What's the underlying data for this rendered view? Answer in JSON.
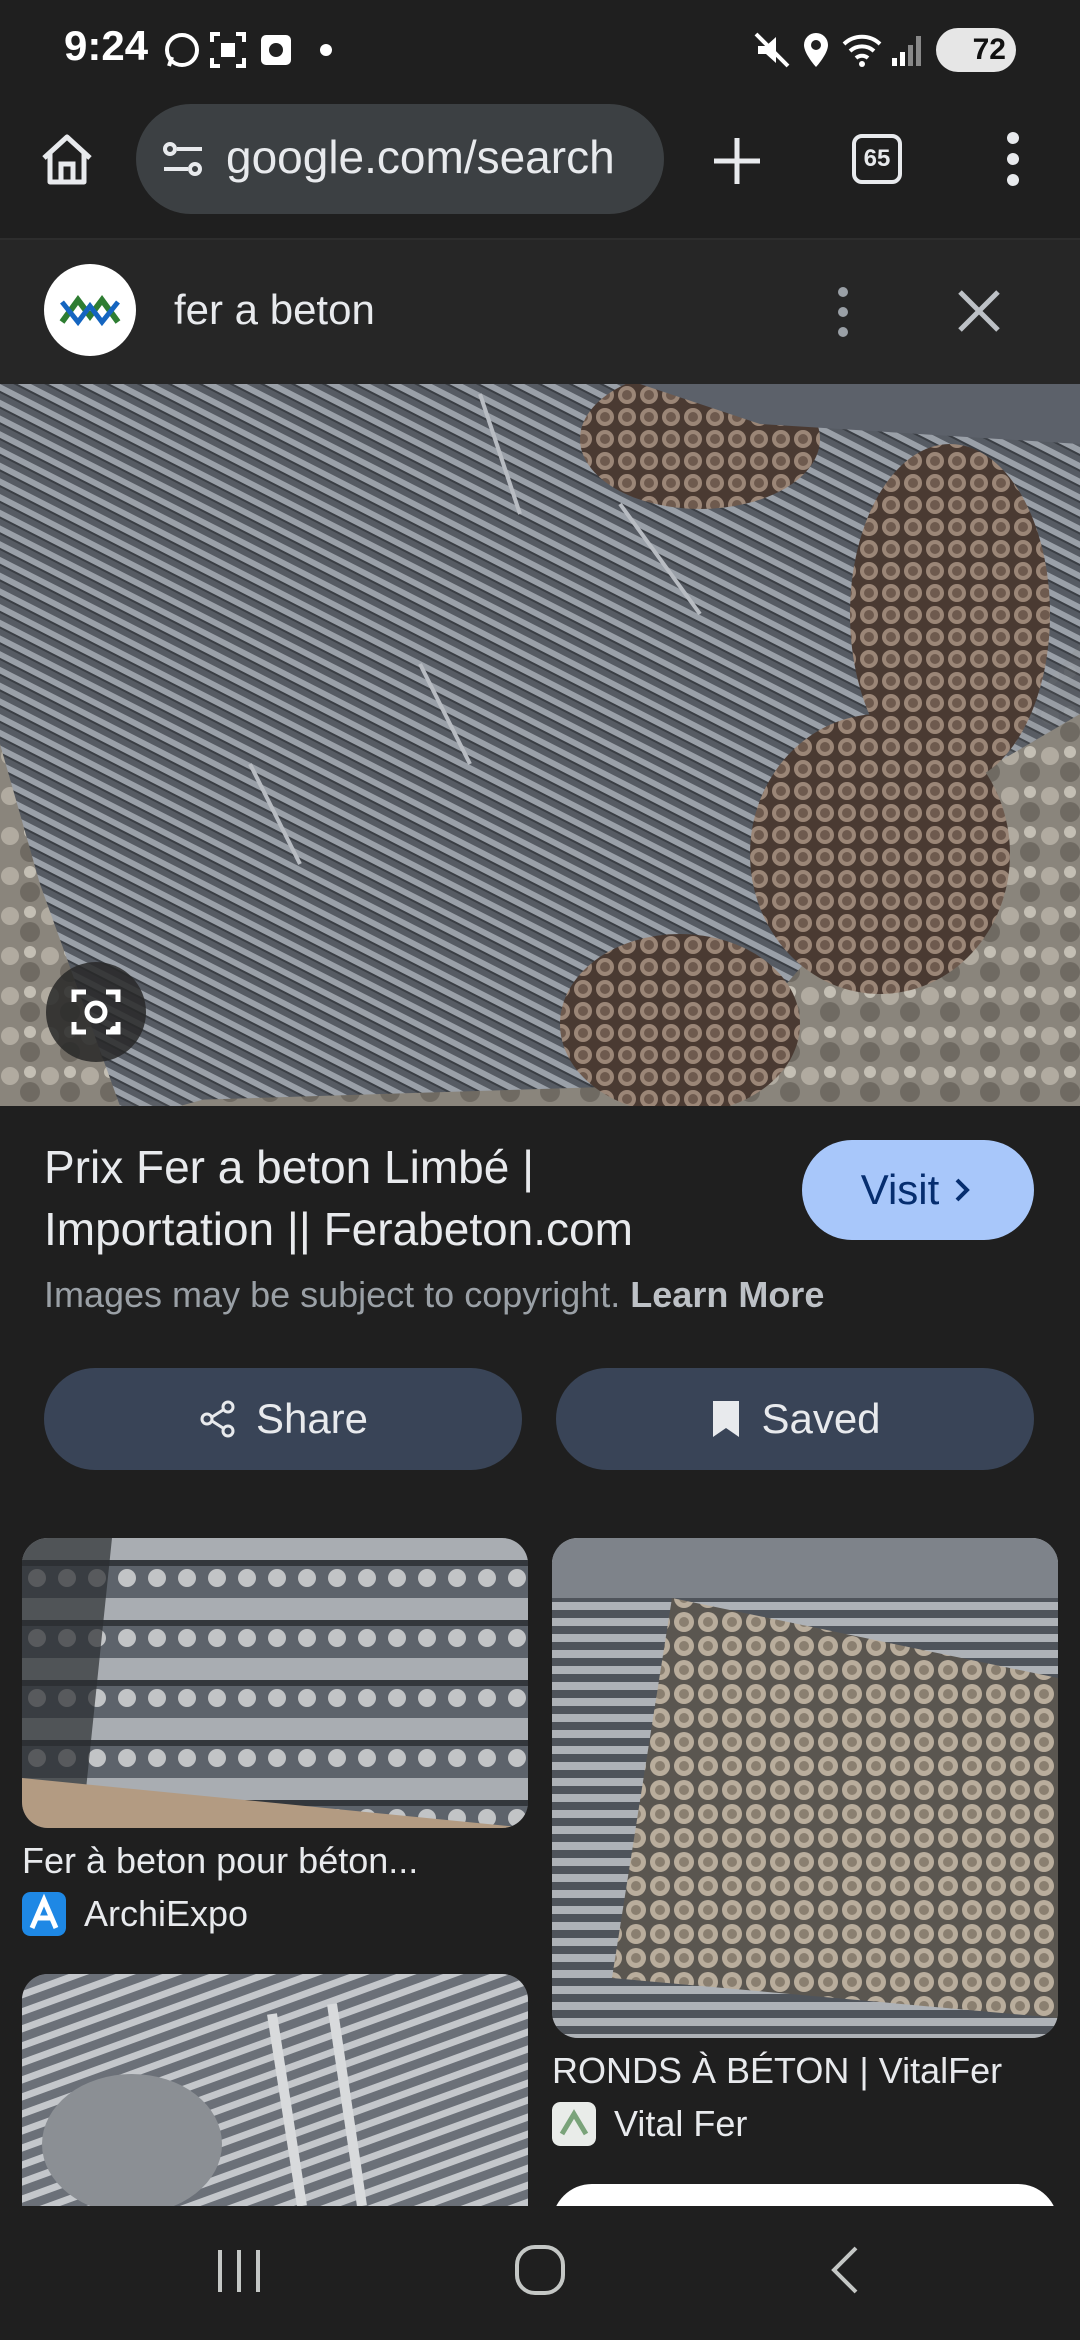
{
  "status_bar": {
    "time": "9:24",
    "battery": "72",
    "left_icons": [
      "whatsapp-icon",
      "screenshot-icon",
      "app-icon",
      "dot-icon"
    ],
    "right_icons": [
      "mute-icon",
      "location-icon",
      "wifi-icon",
      "signal-icon",
      "battery-icon"
    ]
  },
  "browser": {
    "url": "google.com/search",
    "tab_count": "65"
  },
  "result_header": {
    "query": "fer a beton"
  },
  "result": {
    "title": "Prix Fer a beton Limbé | Importation || Ferabeton.com",
    "visit_label": "Visit",
    "copyright_text": "Images may be subject to copyright.",
    "learn_more": "Learn More",
    "share_label": "Share",
    "saved_label": "Saved"
  },
  "related": [
    {
      "title": "Fer à beton pour béton...",
      "source": "ArchiExpo"
    },
    {
      "title": "RONDS À BÉTON | VitalFer",
      "source": "Vital Fer"
    }
  ],
  "colors": {
    "background": "#1f1f1f",
    "visit_button": "#a8c7fa",
    "pill_button": "#394457"
  }
}
